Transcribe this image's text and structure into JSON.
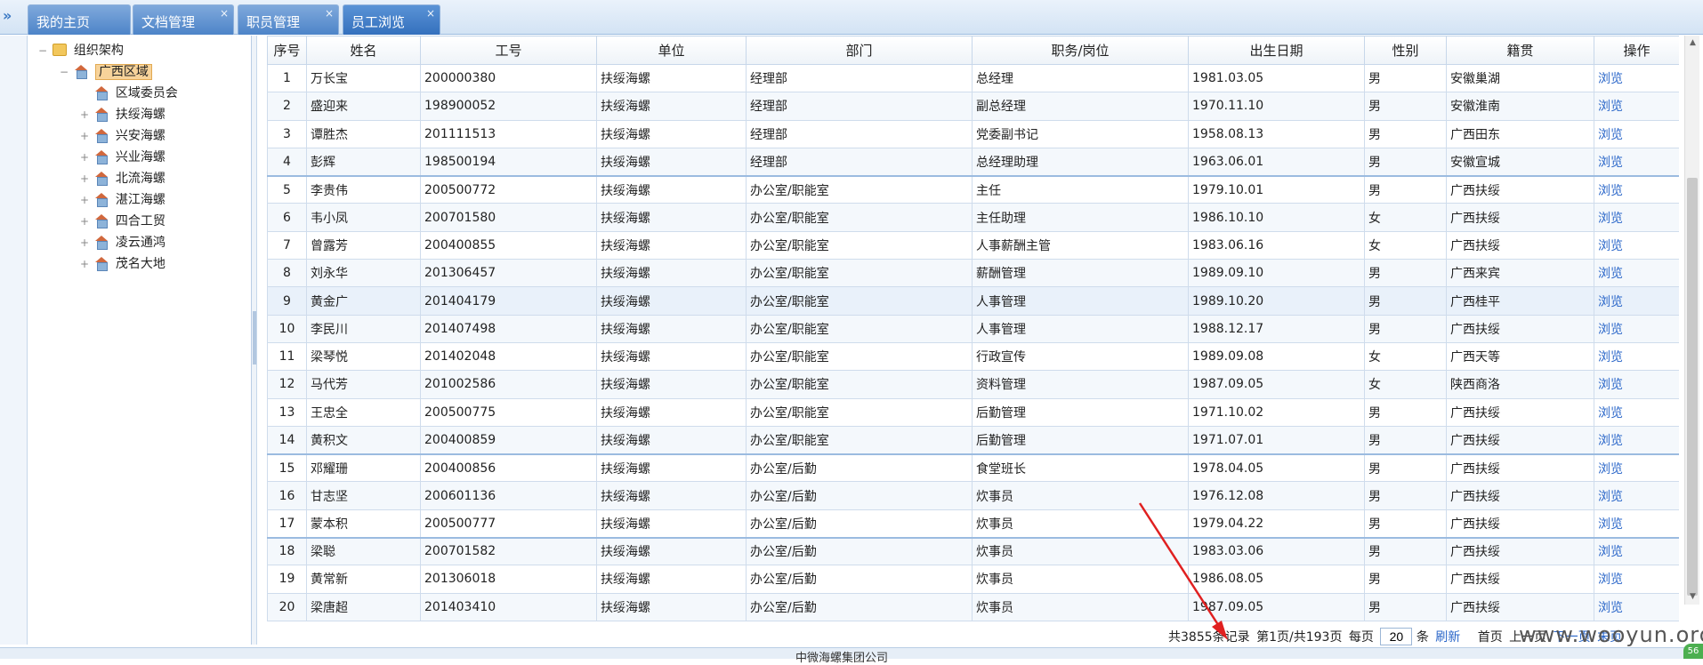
{
  "tabs": [
    {
      "label": "我的主页",
      "closable": false,
      "active": false
    },
    {
      "label": "文档管理",
      "closable": true,
      "active": false
    },
    {
      "label": "职员管理",
      "closable": true,
      "active": false
    },
    {
      "label": "员工浏览",
      "closable": true,
      "active": true
    }
  ],
  "tab_close_glyph": "×",
  "collapse_glyph": "»",
  "tree": {
    "root": "组织架构",
    "region": "广西区域",
    "children": [
      "区域委员会",
      "扶绥海螺",
      "兴安海螺",
      "兴业海螺",
      "北流海螺",
      "湛江海螺",
      "四合工贸",
      "凌云通鸿",
      "茂名大地"
    ]
  },
  "grid": {
    "columns": [
      "序号",
      "姓名",
      "工号",
      "单位",
      "部门",
      "职务/岗位",
      "出生日期",
      "性别",
      "籍贯",
      "操作"
    ],
    "action_label": "浏览",
    "rows": [
      [
        "1",
        "万长宝",
        "200000380",
        "扶绥海螺",
        "经理部",
        "总经理",
        "1981.03.05",
        "男",
        "安徽巢湖"
      ],
      [
        "2",
        "盛迎来",
        "198900052",
        "扶绥海螺",
        "经理部",
        "副总经理",
        "1970.11.10",
        "男",
        "安徽淮南"
      ],
      [
        "3",
        "谭胜杰",
        "201111513",
        "扶绥海螺",
        "经理部",
        "党委副书记",
        "1958.08.13",
        "男",
        "广西田东"
      ],
      [
        "4",
        "彭辉",
        "198500194",
        "扶绥海螺",
        "经理部",
        "总经理助理",
        "1963.06.01",
        "男",
        "安徽宣城"
      ],
      [
        "5",
        "李贵伟",
        "200500772",
        "扶绥海螺",
        "办公室/职能室",
        "主任",
        "1979.10.01",
        "男",
        "广西扶绥"
      ],
      [
        "6",
        "韦小凤",
        "200701580",
        "扶绥海螺",
        "办公室/职能室",
        "主任助理",
        "1986.10.10",
        "女",
        "广西扶绥"
      ],
      [
        "7",
        "曾露芳",
        "200400855",
        "扶绥海螺",
        "办公室/职能室",
        "人事薪酬主管",
        "1983.06.16",
        "女",
        "广西扶绥"
      ],
      [
        "8",
        "刘永华",
        "201306457",
        "扶绥海螺",
        "办公室/职能室",
        "薪酬管理",
        "1989.09.10",
        "男",
        "广西来宾"
      ],
      [
        "9",
        "黄金广",
        "201404179",
        "扶绥海螺",
        "办公室/职能室",
        "人事管理",
        "1989.10.20",
        "男",
        "广西桂平"
      ],
      [
        "10",
        "李民川",
        "201407498",
        "扶绥海螺",
        "办公室/职能室",
        "人事管理",
        "1988.12.17",
        "男",
        "广西扶绥"
      ],
      [
        "11",
        "梁琴悦",
        "201402048",
        "扶绥海螺",
        "办公室/职能室",
        "行政宣传",
        "1989.09.08",
        "女",
        "广西天等"
      ],
      [
        "12",
        "马代芳",
        "201002586",
        "扶绥海螺",
        "办公室/职能室",
        "资料管理",
        "1987.09.05",
        "女",
        "陕西商洛"
      ],
      [
        "13",
        "王忠全",
        "200500775",
        "扶绥海螺",
        "办公室/职能室",
        "后勤管理",
        "1971.10.02",
        "男",
        "广西扶绥"
      ],
      [
        "14",
        "黄积文",
        "200400859",
        "扶绥海螺",
        "办公室/职能室",
        "后勤管理",
        "1971.07.01",
        "男",
        "广西扶绥"
      ],
      [
        "15",
        "邓耀珊",
        "200400856",
        "扶绥海螺",
        "办公室/后勤",
        "食堂班长",
        "1978.04.05",
        "男",
        "广西扶绥"
      ],
      [
        "16",
        "甘志坚",
        "200601136",
        "扶绥海螺",
        "办公室/后勤",
        "炊事员",
        "1976.12.08",
        "男",
        "广西扶绥"
      ],
      [
        "17",
        "蒙本积",
        "200500777",
        "扶绥海螺",
        "办公室/后勤",
        "炊事员",
        "1979.04.22",
        "男",
        "广西扶绥"
      ],
      [
        "18",
        "梁聪",
        "200701582",
        "扶绥海螺",
        "办公室/后勤",
        "炊事员",
        "1983.03.06",
        "男",
        "广西扶绥"
      ],
      [
        "19",
        "黄常新",
        "201306018",
        "扶绥海螺",
        "办公室/后勤",
        "炊事员",
        "1986.08.05",
        "男",
        "广西扶绥"
      ],
      [
        "20",
        "梁唐超",
        "201403410",
        "扶绥海螺",
        "办公室/后勤",
        "炊事员",
        "1987.09.05",
        "男",
        "广西扶绥"
      ]
    ]
  },
  "pager": {
    "total": "共3855条记录",
    "page_info": "第1页/共193页",
    "per_page_label": "每页",
    "per_page_value": "20",
    "per_page_unit": "条",
    "refresh": "刷新",
    "first": "首页",
    "prev": "上一页",
    "next": "下一页",
    "last": "末页"
  },
  "footer": "中微海螺集团公司",
  "watermark": "www.wooyun.org",
  "corner_badge": "56",
  "colors": {
    "accent": "#4d84c8",
    "link": "#2b67c9",
    "annotation": "#e02020"
  }
}
